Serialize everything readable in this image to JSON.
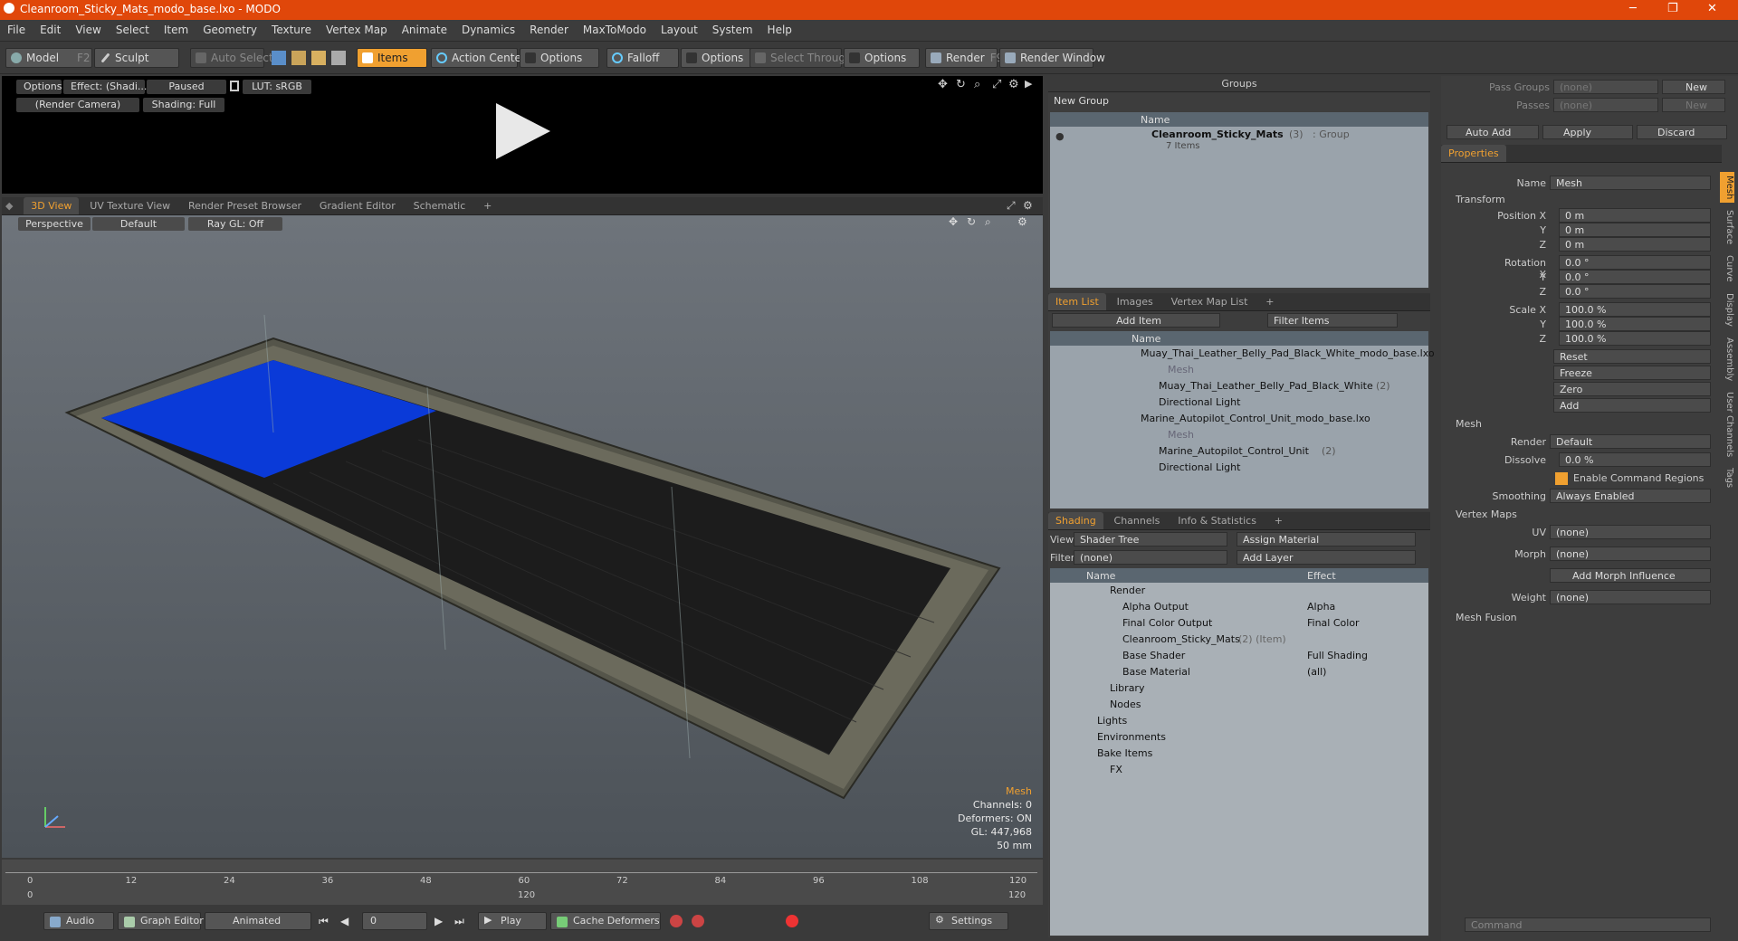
{
  "window": {
    "title": "Cleanroom_Sticky_Mats_modo_base.lxo - MODO",
    "minimize": "─",
    "maximize": "❐",
    "close": "✕"
  },
  "menu": [
    "File",
    "Edit",
    "View",
    "Select",
    "Item",
    "Geometry",
    "Texture",
    "Vertex Map",
    "Animate",
    "Dynamics",
    "Render",
    "MaxToModo",
    "Layout",
    "System",
    "Help"
  ],
  "toolbar": {
    "model": "Model",
    "model_key": "F2",
    "sculpt": "Sculpt",
    "auto_select": "Auto Select",
    "items": "Items",
    "action_center": "Action Center",
    "options1": "Options",
    "falloff": "Falloff",
    "options2": "Options",
    "select_through": "Select Through",
    "options3": "Options",
    "render": "Render",
    "render_key": "F9",
    "render_window": "Render Window"
  },
  "preview": {
    "options": "Options",
    "effect": "Effect: (Shadi...",
    "paused": "Paused",
    "lut": "LUT: sRGB",
    "camera": "(Render Camera)",
    "shading": "Shading: Full"
  },
  "viewtabs": [
    "3D View",
    "UV Texture View",
    "Render Preset Browser",
    "Gradient Editor",
    "Schematic",
    "+"
  ],
  "viewport": {
    "perspective": "Perspective",
    "default": "Default",
    "raygl": "Ray GL: Off",
    "stats": {
      "label": "Mesh",
      "channels": "Channels: 0",
      "deformers": "Deformers: ON",
      "gl": "GL: 447,968",
      "size": "50 mm"
    }
  },
  "timeline": {
    "ticks": [
      "0",
      "12",
      "24",
      "36",
      "48",
      "60",
      "72",
      "84",
      "96",
      "108",
      "120"
    ],
    "sub": [
      "0",
      "120",
      "120"
    ]
  },
  "bottom": {
    "audio": "Audio",
    "graph": "Graph Editor",
    "animated": "Animated",
    "frame": "0",
    "play": "Play",
    "cache": "Cache Deformers",
    "settings": "Settings"
  },
  "groups": {
    "title": "Groups",
    "new_group": "New Group",
    "col_name": "Name",
    "item_name": "Cleanroom_Sticky_Mats",
    "item_count": "(3)",
    "item_type": ": Group",
    "item_sub": "7 Items"
  },
  "itemlist": {
    "tabs": [
      "Item List",
      "Images",
      "Vertex Map List",
      "+"
    ],
    "add_item": "Add Item",
    "filter": "Filter Items",
    "col_name": "Name",
    "rows": [
      {
        "text": "Muay_Thai_Leather_Belly_Pad_Black_White_modo_base.lxo",
        "indent": 0,
        "dim": false
      },
      {
        "text": "Mesh",
        "indent": 2,
        "dim": true
      },
      {
        "text": "Muay_Thai_Leather_Belly_Pad_Black_White",
        "indent": 1,
        "dim": false,
        "count": "(2)"
      },
      {
        "text": "Directional Light",
        "indent": 1,
        "dim": false
      },
      {
        "text": "Marine_Autopilot_Control_Unit_modo_base.lxo",
        "indent": 0,
        "dim": false
      },
      {
        "text": "Mesh",
        "indent": 2,
        "dim": true
      },
      {
        "text": "Marine_Autopilot_Control_Unit",
        "indent": 1,
        "dim": false,
        "count": "(2)"
      },
      {
        "text": "Directional Light",
        "indent": 1,
        "dim": false
      }
    ]
  },
  "shading": {
    "tabs": [
      "Shading",
      "Channels",
      "Info & Statistics",
      "+"
    ],
    "view_label": "View",
    "view_value": "Shader Tree",
    "assign": "Assign Material",
    "filter_label": "Filter",
    "filter_value": "(none)",
    "add_layer": "Add Layer",
    "col_name": "Name",
    "col_effect": "Effect",
    "rows": [
      {
        "name": "Render",
        "effect": ""
      },
      {
        "name": "Alpha Output",
        "effect": "Alpha"
      },
      {
        "name": "Final Color Output",
        "effect": "Final Color"
      },
      {
        "name": "Cleanroom_Sticky_Mats",
        "effect": "",
        "extra": "(2) (Item)"
      },
      {
        "name": "Base Shader",
        "effect": "Full Shading"
      },
      {
        "name": "Base Material",
        "effect": "(all)"
      },
      {
        "name": "Library",
        "effect": ""
      },
      {
        "name": "Nodes",
        "effect": ""
      },
      {
        "name": "Lights",
        "effect": ""
      },
      {
        "name": "Environments",
        "effect": ""
      },
      {
        "name": "Bake Items",
        "effect": ""
      },
      {
        "name": "FX",
        "effect": ""
      }
    ]
  },
  "props": {
    "pass_groups": "Pass Groups",
    "passes": "Passes",
    "none": "(none)",
    "new": "New",
    "auto_add": "Auto Add",
    "apply": "Apply",
    "discard": "Discard",
    "tab": "Properties",
    "name_label": "Name",
    "name_value": "Mesh",
    "transform": "Transform",
    "pos_label": "Position X",
    "rot_label": "Rotation X",
    "scale_label": "Scale X",
    "y": "Y",
    "z": "Z",
    "pos": [
      "0 m",
      "0 m",
      "0 m"
    ],
    "rot": [
      "0.0 °",
      "0.0 °",
      "0.0 °"
    ],
    "scale": [
      "100.0 %",
      "100.0 %",
      "100.0 %"
    ],
    "reset": "Reset",
    "freeze": "Freeze",
    "zero": "Zero",
    "add": "Add",
    "mesh": "Mesh",
    "render_label": "Render",
    "render_value": "Default",
    "dissolve_label": "Dissolve",
    "dissolve_value": "0.0 %",
    "enable_cmd": "Enable Command Regions",
    "smoothing_label": "Smoothing",
    "smoothing_value": "Always Enabled",
    "vertex_maps": "Vertex Maps",
    "uv_label": "UV",
    "uv_value": "(none)",
    "morph_label": "Morph",
    "morph_value": "(none)",
    "add_morph": "Add Morph Influence",
    "weight_label": "Weight",
    "weight_value": "(none)",
    "mesh_fusion": "Mesh Fusion",
    "side_tabs": [
      "Mesh",
      "Surface",
      "Curve",
      "Display",
      "Assembly",
      "User Channels",
      "Tags"
    ],
    "command": "Command"
  }
}
